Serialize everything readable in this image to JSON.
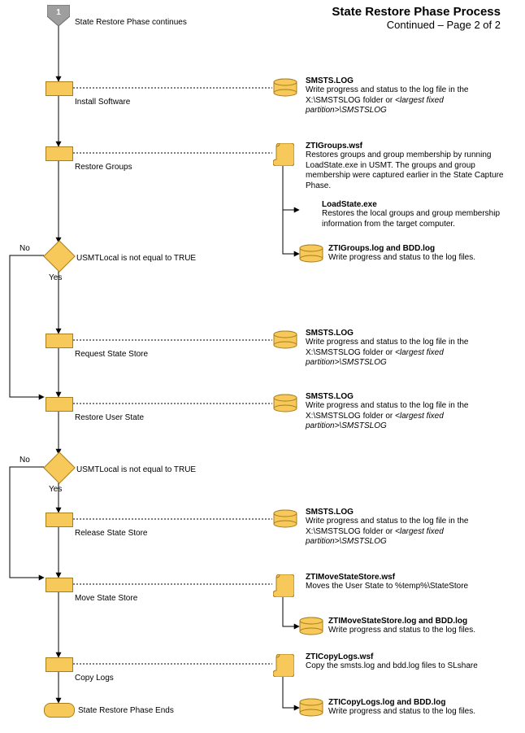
{
  "title": {
    "main": "State Restore Phase Process",
    "sub": "Continued – Page 2 of 2"
  },
  "start_badge": "1",
  "start_label": "State Restore Phase continues",
  "steps": {
    "install_software": "Install Software",
    "restore_groups": "Restore Groups",
    "decision1": "USMTLocal is not equal to TRUE",
    "request_state_store": "Request State Store",
    "restore_user_state": "Restore User State",
    "decision2": "USMTLocal is not equal to TRUE",
    "release_state_store": "Release State Store",
    "move_state_store": "Move State Store",
    "copy_logs": "Copy Logs",
    "end": "State Restore Phase Ends"
  },
  "branches": {
    "no": "No",
    "yes": "Yes"
  },
  "notes": {
    "smsts": {
      "hd": "SMSTS.LOG",
      "body_pre": "Write progress and status to the log file in the X:\\SMSTSLOG folder or ",
      "body_ital": "<largest fixed partition>\\SMSTSLOG"
    },
    "ztigroups_wsf": {
      "hd": "ZTIGroups.wsf",
      "body": "Restores groups and group membership by running LoadState.exe in USMT. The groups and group membership were captured earlier in the State Capture Phase."
    },
    "loadstate": {
      "hd": "LoadState.exe",
      "body": "Restores the local groups and group membership information from the target computer."
    },
    "ztigroups_log": {
      "hd": "ZTIGroups.log and BDD.log",
      "body": "Write progress and status to the log files."
    },
    "ztimove_wsf": {
      "hd": "ZTIMoveStateStore.wsf",
      "body": "Moves the User State to %temp%\\StateStore"
    },
    "ztimove_log": {
      "hd": "ZTIMoveStateStore.log and BDD.log",
      "body": "Write progress and status to the log files."
    },
    "zticopy_wsf": {
      "hd": "ZTICopyLogs.wsf",
      "body": "Copy the smsts.log and bdd.log files to SLshare"
    },
    "zticopy_log": {
      "hd": "ZTICopyLogs.log and BDD.log",
      "body": "Write progress and status to the log files."
    }
  },
  "chart_data": {
    "type": "flowchart",
    "title": "State Restore Phase Process (Continued – Page 2 of 2)",
    "nodes": [
      {
        "id": "start",
        "type": "off-page-connector",
        "label": "1",
        "caption": "State Restore Phase continues"
      },
      {
        "id": "install_software",
        "type": "process",
        "label": "Install Software"
      },
      {
        "id": "restore_groups",
        "type": "process",
        "label": "Restore Groups"
      },
      {
        "id": "d1",
        "type": "decision",
        "label": "USMTLocal is not equal to TRUE"
      },
      {
        "id": "request_state_store",
        "type": "process",
        "label": "Request State Store"
      },
      {
        "id": "restore_user_state",
        "type": "process",
        "label": "Restore User State"
      },
      {
        "id": "d2",
        "type": "decision",
        "label": "USMTLocal is not equal to TRUE"
      },
      {
        "id": "release_state_store",
        "type": "process",
        "label": "Release State Store"
      },
      {
        "id": "move_state_store",
        "type": "process",
        "label": "Move State Store"
      },
      {
        "id": "copy_logs",
        "type": "process",
        "label": "Copy Logs"
      },
      {
        "id": "end",
        "type": "terminator",
        "label": "State Restore Phase Ends"
      }
    ],
    "edges": [
      {
        "from": "start",
        "to": "install_software"
      },
      {
        "from": "install_software",
        "to": "restore_groups"
      },
      {
        "from": "restore_groups",
        "to": "d1"
      },
      {
        "from": "d1",
        "to": "request_state_store",
        "label": "Yes"
      },
      {
        "from": "d1",
        "to": "restore_user_state",
        "label": "No",
        "note": "bypass Request State Store"
      },
      {
        "from": "request_state_store",
        "to": "restore_user_state"
      },
      {
        "from": "restore_user_state",
        "to": "d2"
      },
      {
        "from": "d2",
        "to": "release_state_store",
        "label": "Yes"
      },
      {
        "from": "d2",
        "to": "move_state_store",
        "label": "No",
        "note": "bypass Release State Store"
      },
      {
        "from": "release_state_store",
        "to": "move_state_store"
      },
      {
        "from": "move_state_store",
        "to": "copy_logs"
      },
      {
        "from": "copy_logs",
        "to": "end"
      }
    ],
    "annotations": [
      {
        "attached_to": "install_software",
        "icon": "database",
        "title": "SMSTS.LOG",
        "text": "Write progress and status to the log file in the X:\\SMSTSLOG folder or <largest fixed partition>\\SMSTSLOG"
      },
      {
        "attached_to": "restore_groups",
        "icon": "script",
        "title": "ZTIGroups.wsf",
        "text": "Restores groups and group membership by running LoadState.exe in USMT. The groups and group membership were captured earlier in the State Capture Phase.",
        "children": [
          {
            "icon": "none",
            "title": "LoadState.exe",
            "text": "Restores the local groups and group membership information from the target computer."
          },
          {
            "icon": "database",
            "title": "ZTIGroups.log and BDD.log",
            "text": "Write progress and status to the log files."
          }
        ]
      },
      {
        "attached_to": "request_state_store",
        "icon": "database",
        "title": "SMSTS.LOG",
        "text": "Write progress and status to the log file in the X:\\SMSTSLOG folder or <largest fixed partition>\\SMSTSLOG"
      },
      {
        "attached_to": "restore_user_state",
        "icon": "database",
        "title": "SMSTS.LOG",
        "text": "Write progress and status to the log file in the X:\\SMSTSLOG folder or <largest fixed partition>\\SMSTSLOG"
      },
      {
        "attached_to": "release_state_store",
        "icon": "database",
        "title": "SMSTS.LOG",
        "text": "Write progress and status to the log file in the X:\\SMSTSLOG folder or <largest fixed partition>\\SMSTSLOG"
      },
      {
        "attached_to": "move_state_store",
        "icon": "script",
        "title": "ZTIMoveStateStore.wsf",
        "text": "Moves the User State to %temp%\\StateStore",
        "children": [
          {
            "icon": "database",
            "title": "ZTIMoveStateStore.log and BDD.log",
            "text": "Write progress and status to the log files."
          }
        ]
      },
      {
        "attached_to": "copy_logs",
        "icon": "script",
        "title": "ZTICopyLogs.wsf",
        "text": "Copy the smsts.log and bdd.log files to SLshare",
        "children": [
          {
            "icon": "database",
            "title": "ZTICopyLogs.log and BDD.log",
            "text": "Write progress and status to the log files."
          }
        ]
      }
    ]
  }
}
